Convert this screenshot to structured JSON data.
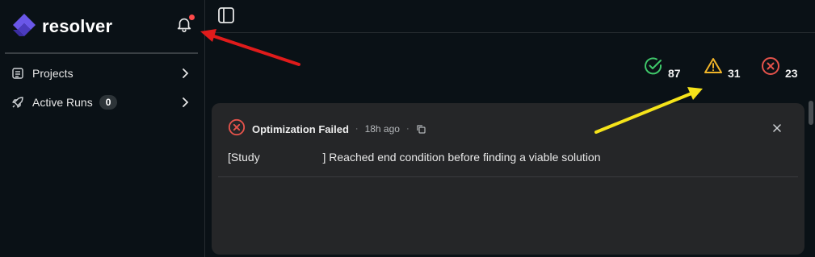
{
  "brand": {
    "name": "resolver",
    "accent": "#5b4bdc"
  },
  "sidebar": {
    "items": [
      {
        "label": "Projects",
        "icon": "list-icon"
      },
      {
        "label": "Active Runs",
        "icon": "rocket-icon",
        "badge": "0"
      }
    ]
  },
  "status": {
    "success": {
      "count": "87",
      "color": "#3fc86a"
    },
    "warning": {
      "count": "31",
      "color": "#f0b429"
    },
    "error": {
      "count": "23",
      "color": "#e5534b"
    }
  },
  "notification": {
    "title": "Optimization Failed",
    "separator": "·",
    "time": "18h ago",
    "message": "[Study                    ] Reached end condition before finding a viable solution"
  },
  "annotations": {
    "red_arrow_color": "#e01b1b",
    "yellow_arrow_color": "#f5e31a"
  }
}
